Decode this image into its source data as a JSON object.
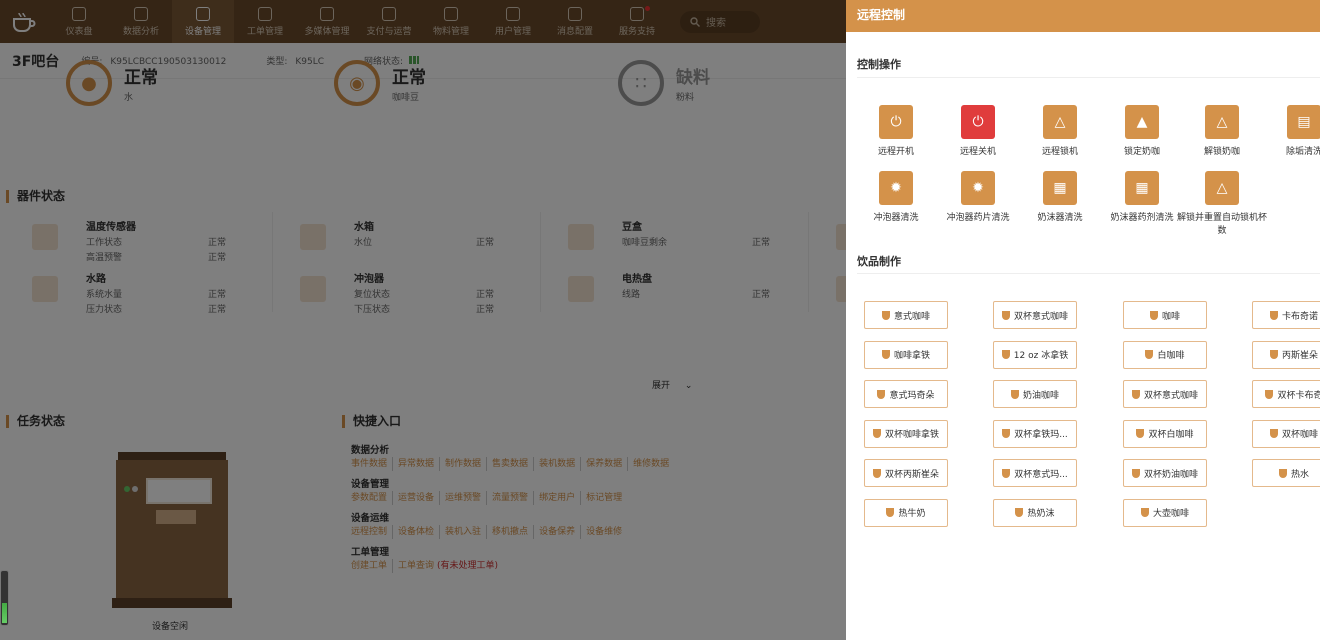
{
  "nav": {
    "items": [
      {
        "label": "仪表盘"
      },
      {
        "label": "数据分析"
      },
      {
        "label": "设备管理"
      },
      {
        "label": "工单管理"
      },
      {
        "label": "多媒体管理"
      },
      {
        "label": "支付与运营"
      },
      {
        "label": "物料管理"
      },
      {
        "label": "用户管理"
      },
      {
        "label": "消息配置"
      },
      {
        "label": "服务支持"
      }
    ],
    "search_placeholder": "搜索"
  },
  "device": {
    "name": "3F吧台",
    "id_label": "编号:",
    "id_value": "K95LCBCC190503130012",
    "type_label": "类型:",
    "type_value": "K95LC",
    "network_label": "网络状态:"
  },
  "status": [
    {
      "state": "正常",
      "material": "水"
    },
    {
      "state": "正常",
      "material": "咖啡豆"
    },
    {
      "state": "缺料",
      "material": "粉料"
    }
  ],
  "components_title": "器件状态",
  "components": [
    {
      "title": "温度传感器",
      "rows": [
        {
          "k": "工作状态",
          "v": "正常"
        },
        {
          "k": "高温预警",
          "v": "正常"
        }
      ]
    },
    {
      "title": "水箱",
      "rows": [
        {
          "k": "水位",
          "v": "正常"
        }
      ]
    },
    {
      "title": "豆盒",
      "rows": [
        {
          "k": "咖啡豆剩余",
          "v": "正常"
        }
      ]
    },
    {
      "title": "水路",
      "rows": [
        {
          "k": "系统水量",
          "v": "正常"
        },
        {
          "k": "压力状态",
          "v": "正常"
        }
      ]
    },
    {
      "title": "冲泡器",
      "rows": [
        {
          "k": "复位状态",
          "v": "正常"
        },
        {
          "k": "下压状态",
          "v": "正常"
        }
      ]
    },
    {
      "title": "电热盘",
      "rows": [
        {
          "k": "线路",
          "v": "正常"
        }
      ]
    }
  ],
  "expand_label": "展开",
  "task_title": "任务状态",
  "idle_label": "设备空闲",
  "quick_title": "快捷入口",
  "quick": [
    {
      "title": "数据分析",
      "links": [
        "事件数据",
        "异常数据",
        "制作数据",
        "售卖数据",
        "装机数据",
        "保养数据",
        "维修数据"
      ]
    },
    {
      "title": "设备管理",
      "links": [
        "参数配置",
        "运营设备",
        "运维预警",
        "流量预警",
        "绑定用户",
        "标记管理"
      ]
    },
    {
      "title": "设备运维",
      "links": [
        "远程控制",
        "设备体检",
        "装机入驻",
        "移机撤点",
        "设备保养",
        "设备维修"
      ]
    },
    {
      "title": "工单管理",
      "links": [
        "创建工单",
        "工单查询"
      ],
      "extra": "(有未处理工单)"
    }
  ],
  "panel": {
    "title": "远程控制",
    "control_title": "控制操作",
    "controls": [
      {
        "label": "远程开机",
        "icon": "power-icon"
      },
      {
        "label": "远程关机",
        "icon": "power-icon"
      },
      {
        "label": "远程锁机",
        "icon": "unlock-icon"
      },
      {
        "label": "锁定奶咖",
        "icon": "lock-icon"
      },
      {
        "label": "解锁奶咖",
        "icon": "unlock-icon"
      },
      {
        "label": "除垢清洗",
        "icon": "descale-icon"
      },
      {
        "label": "冲泡器清洗",
        "icon": "brewer-clean-icon"
      },
      {
        "label": "冲泡器药片清洗",
        "icon": "tablet-clean-icon"
      },
      {
        "label": "奶沫器清洗",
        "icon": "frother-clean-icon"
      },
      {
        "label": "奶沫器药剂清洗",
        "icon": "frother-agent-icon"
      },
      {
        "label": "解锁并重置自动锁机杯数",
        "icon": "unlock-icon"
      }
    ],
    "drink_title": "饮品制作",
    "drinks": [
      "意式咖啡",
      "双杯意式咖啡",
      "咖啡",
      "卡布奇诺",
      "咖啡拿铁",
      "12 oz 冰拿铁",
      "白咖啡",
      "丙斯崔朵",
      "意式玛奇朵",
      "奶油咖啡",
      "双杯意式咖啡",
      "双杯卡布奇",
      "双杯咖啡拿铁",
      "双杯拿铁玛...",
      "双杯白咖啡",
      "双杯咖啡",
      "双杯丙斯崔朵",
      "双杯意式玛...",
      "双杯奶油咖啡",
      "热水",
      "热牛奶",
      "热奶沫",
      "大壶咖啡"
    ]
  },
  "colors": {
    "accent": "#d4924a",
    "nav_bg": "#6b4a2b",
    "danger": "#e03c3c"
  }
}
